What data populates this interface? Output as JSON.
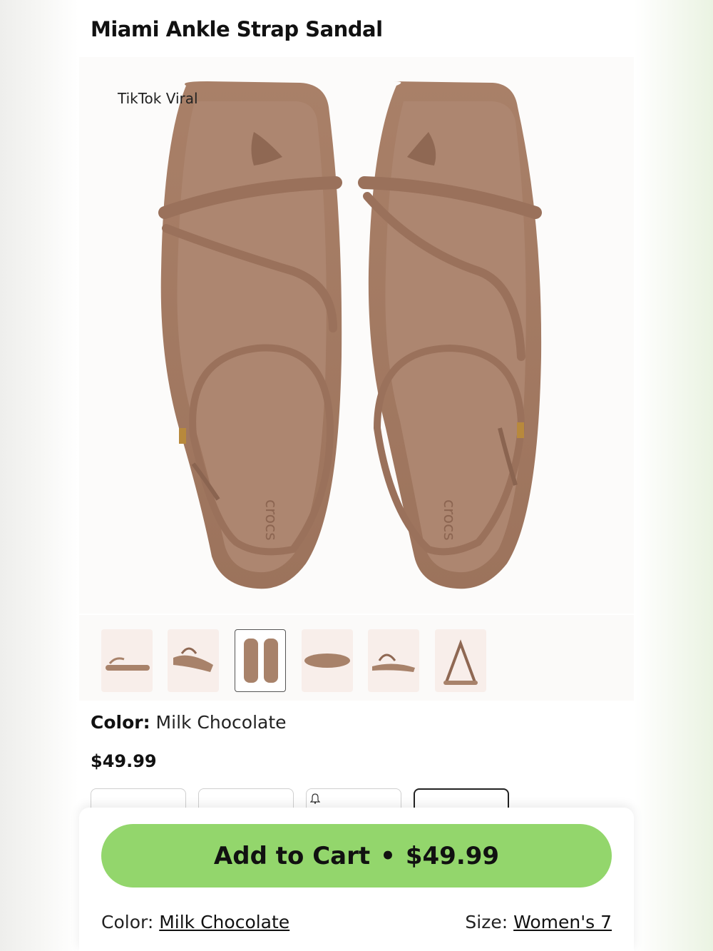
{
  "product": {
    "title": "Miami Ankle Strap Sandal",
    "badge": "TikTok Viral",
    "color_label": "Color:",
    "color_value": "Milk Chocolate",
    "price": "$49.99"
  },
  "thumbnails": [
    {
      "view": "side-view",
      "selected": false
    },
    {
      "view": "angle-view",
      "selected": false
    },
    {
      "view": "top-pair-view",
      "selected": true
    },
    {
      "view": "sole-view",
      "selected": false
    },
    {
      "view": "angle-view-2",
      "selected": false
    },
    {
      "view": "back-view",
      "selected": false
    }
  ],
  "sheet": {
    "cart_label": "Add to Cart",
    "separator": "•",
    "cart_price": "$49.99",
    "color_label": "Color:",
    "color_value": "Milk Chocolate",
    "size_label": "Size:",
    "size_value": "Women's 7"
  },
  "colors": {
    "accent": "#93d66c",
    "sandal": "#a8826a"
  }
}
